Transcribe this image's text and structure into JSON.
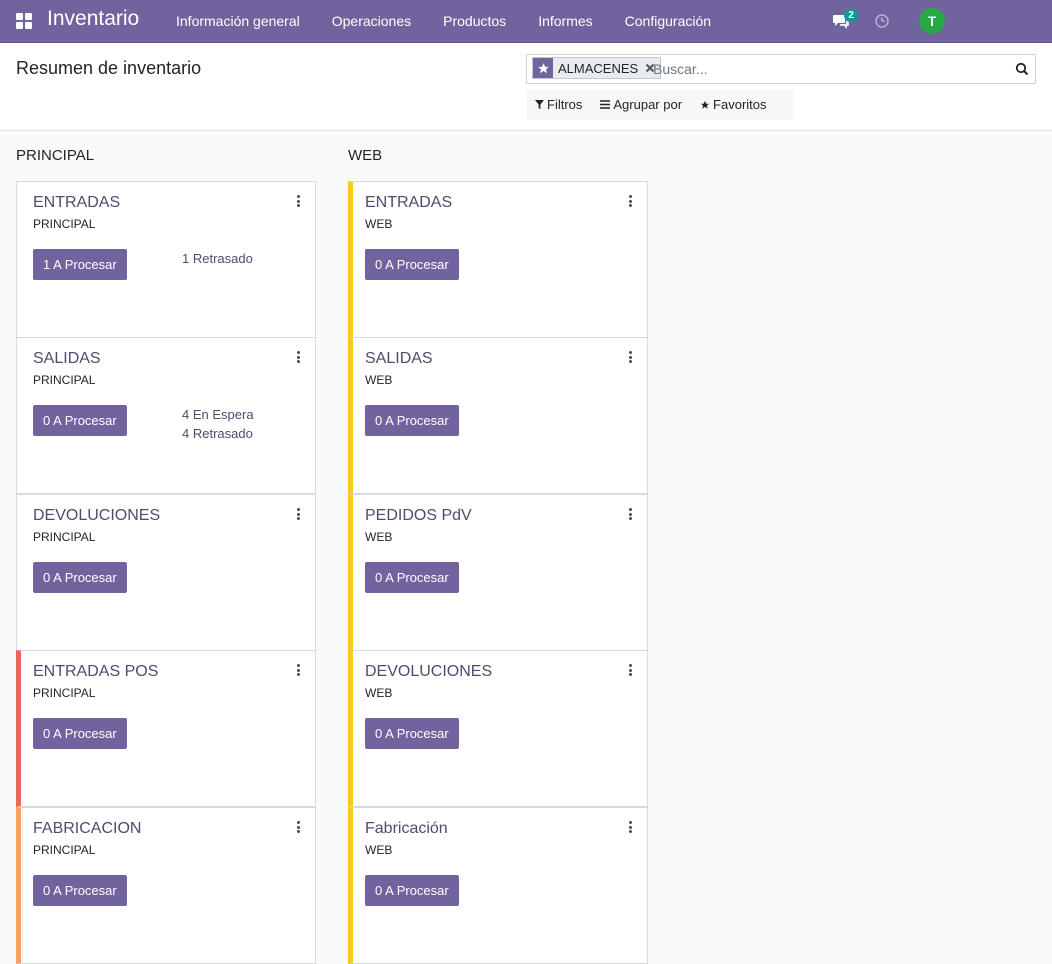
{
  "navbar": {
    "brand": "Inventario",
    "menu": [
      "Información general",
      "Operaciones",
      "Productos",
      "Informes",
      "Configuración"
    ],
    "chat_count": "2",
    "avatar_initial": "T",
    "bg_color": "#71639e"
  },
  "control_panel": {
    "title": "Resumen de inventario",
    "facet_label": "ALMACENES",
    "search_placeholder": "Buscar...",
    "filters_label": "Filtros",
    "group_by_label": "Agrupar por",
    "favorites_label": "Favoritos"
  },
  "columns": [
    {
      "title": "PRINCIPAL",
      "cards": [
        {
          "title": "ENTRADAS",
          "subtitle": "PRINCIPAL",
          "button": "1 A Procesar",
          "links": [
            "1 Retrasado"
          ],
          "accent": ""
        },
        {
          "title": "SALIDAS",
          "subtitle": "PRINCIPAL",
          "button": "0 A Procesar",
          "links": [
            "4 En Espera",
            "4 Retrasado"
          ],
          "accent": ""
        },
        {
          "title": "DEVOLUCIONES",
          "subtitle": "PRINCIPAL",
          "button": "0 A Procesar",
          "links": [],
          "accent": ""
        },
        {
          "title": "ENTRADAS POS",
          "subtitle": "PRINCIPAL",
          "button": "0 A Procesar",
          "links": [],
          "accent": "#e8685c"
        },
        {
          "title": "FABRICACION",
          "subtitle": "PRINCIPAL",
          "button": "0 A Procesar",
          "links": [],
          "accent": "#f4a460"
        }
      ]
    },
    {
      "title": "WEB",
      "cards": [
        {
          "title": "ENTRADAS",
          "subtitle": "WEB",
          "button": "0 A Procesar",
          "links": [],
          "accent": "#f4cc1c"
        },
        {
          "title": "SALIDAS",
          "subtitle": "WEB",
          "button": "0 A Procesar",
          "links": [],
          "accent": "#f4cc1c"
        },
        {
          "title": "PEDIDOS PdV",
          "subtitle": "WEB",
          "button": "0 A Procesar",
          "links": [],
          "accent": "#f4cc1c"
        },
        {
          "title": "DEVOLUCIONES",
          "subtitle": "WEB",
          "button": "0 A Procesar",
          "links": [],
          "accent": "#f4cc1c"
        },
        {
          "title": "Fabricación",
          "subtitle": "WEB",
          "button": "0 A Procesar",
          "links": [],
          "accent": "#f4cc1c"
        }
      ]
    }
  ]
}
